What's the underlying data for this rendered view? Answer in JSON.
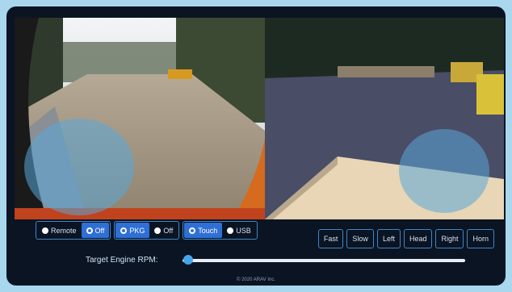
{
  "colors": {
    "accent": "#2f6fd6",
    "border": "#3f86c9",
    "slider_thumb": "#47a4ea",
    "frame": "#a9d8ee"
  },
  "cameras": {
    "left": {
      "icon": "camera-feed-front"
    },
    "right": {
      "icon": "camera-feed-rear"
    }
  },
  "mode_groups": [
    {
      "options": [
        {
          "label": "Remote",
          "selected": false
        },
        {
          "label": "Off",
          "selected": true
        }
      ]
    },
    {
      "options": [
        {
          "label": "PKG",
          "selected": true
        },
        {
          "label": "Off",
          "selected": false
        }
      ]
    },
    {
      "options": [
        {
          "label": "Touch",
          "selected": true
        },
        {
          "label": "USB",
          "selected": false
        }
      ]
    }
  ],
  "direction_buttons": [
    "Fast",
    "Slow",
    "Left",
    "Head",
    "Right",
    "Horn"
  ],
  "rpm": {
    "label": "Target Engine RPM:",
    "value_fraction": 0.02
  },
  "footer": "© 2020 ARAV Inc."
}
